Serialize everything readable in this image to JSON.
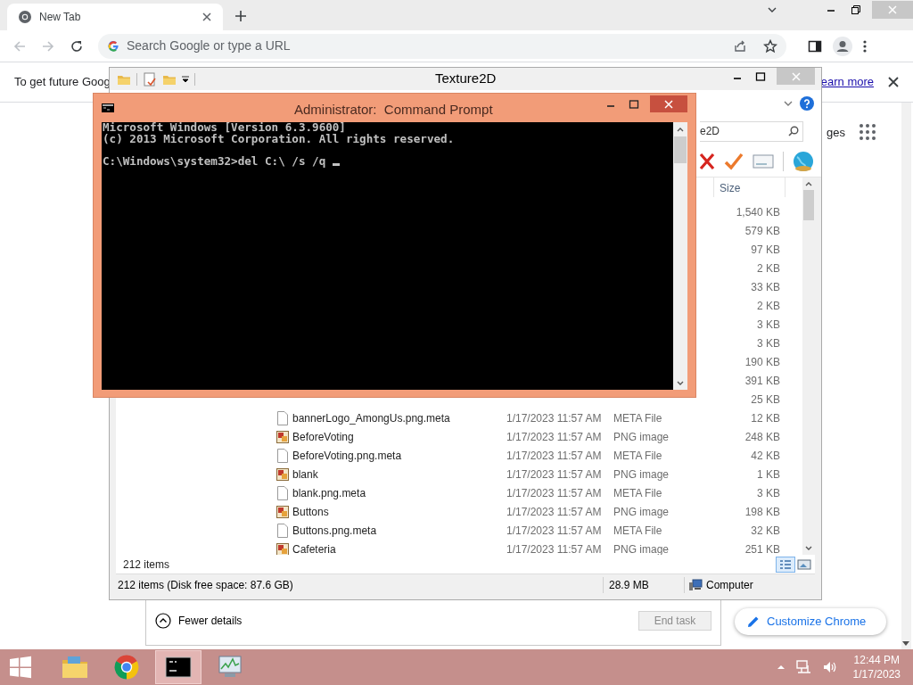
{
  "browser": {
    "tab": {
      "title": "New Tab",
      "selected": true
    },
    "omnibox": {
      "placeholder": "Search Google or type a URL"
    },
    "info_bar": {
      "text": "To get future Goog",
      "link": "earn more"
    },
    "page": {
      "images_link": "ges",
      "customize_button": "Customize Chrome"
    }
  },
  "task_manager": {
    "toggle": "Fewer details",
    "end_task": {
      "label": "End task",
      "disabled": true
    }
  },
  "explorer": {
    "title": "Texture2D",
    "search": {
      "value": "e2D"
    },
    "columns": [
      {
        "label": "Size"
      }
    ],
    "rows": [
      {
        "size": "1,540 KB"
      },
      {
        "size": "579 KB"
      },
      {
        "size": "97 KB"
      },
      {
        "size": "2 KB"
      },
      {
        "size": "33 KB"
      },
      {
        "size": "2 KB"
      },
      {
        "size": "3 KB"
      },
      {
        "size": "3 KB"
      },
      {
        "size": "190 KB"
      },
      {
        "size": "391 KB"
      },
      {
        "size": "25 KB"
      },
      {
        "kind": "file",
        "name": "bannerLogo_AmongUs.png.meta",
        "date": "1/17/2023 11:57 AM",
        "type": "META File",
        "size": "12 KB"
      },
      {
        "kind": "image",
        "name": "BeforeVoting",
        "date": "1/17/2023 11:57 AM",
        "type": "PNG image",
        "size": "248 KB"
      },
      {
        "kind": "file",
        "name": "BeforeVoting.png.meta",
        "date": "1/17/2023 11:57 AM",
        "type": "META File",
        "size": "42 KB"
      },
      {
        "kind": "image",
        "name": "blank",
        "date": "1/17/2023 11:57 AM",
        "type": "PNG image",
        "size": "1 KB"
      },
      {
        "kind": "file",
        "name": "blank.png.meta",
        "date": "1/17/2023 11:57 AM",
        "type": "META File",
        "size": "3 KB"
      },
      {
        "kind": "image",
        "name": "Buttons",
        "date": "1/17/2023 11:57 AM",
        "type": "PNG image",
        "size": "198 KB"
      },
      {
        "kind": "file",
        "name": "Buttons.png.meta",
        "date": "1/17/2023 11:57 AM",
        "type": "META File",
        "size": "32 KB"
      },
      {
        "kind": "image",
        "name": "Cafeteria",
        "date": "1/17/2023 11:57 AM",
        "type": "PNG image",
        "size": "251 KB"
      }
    ],
    "items_count": "212 items",
    "status_bar": {
      "items": "212 items (Disk free space: 87.6 GB)",
      "size": "28.9 MB",
      "location": "Computer"
    }
  },
  "cmd": {
    "title": "Administrator:  Command Prompt",
    "header_lines": [
      "Microsoft Windows [Version 6.3.9600]",
      "(c) 2013 Microsoft Corporation. All rights reserved."
    ],
    "prompt": "C:\\Windows\\system32>del C:\\ /s /q"
  },
  "taskbar": {
    "items": [
      {
        "kind": "explorer",
        "selected": false
      },
      {
        "kind": "chrome",
        "selected": false
      },
      {
        "kind": "cmd",
        "selected": true
      },
      {
        "kind": "taskmgr",
        "selected": false
      }
    ],
    "clock": {
      "time": "12:44 PM",
      "date": "1/17/2023"
    }
  }
}
